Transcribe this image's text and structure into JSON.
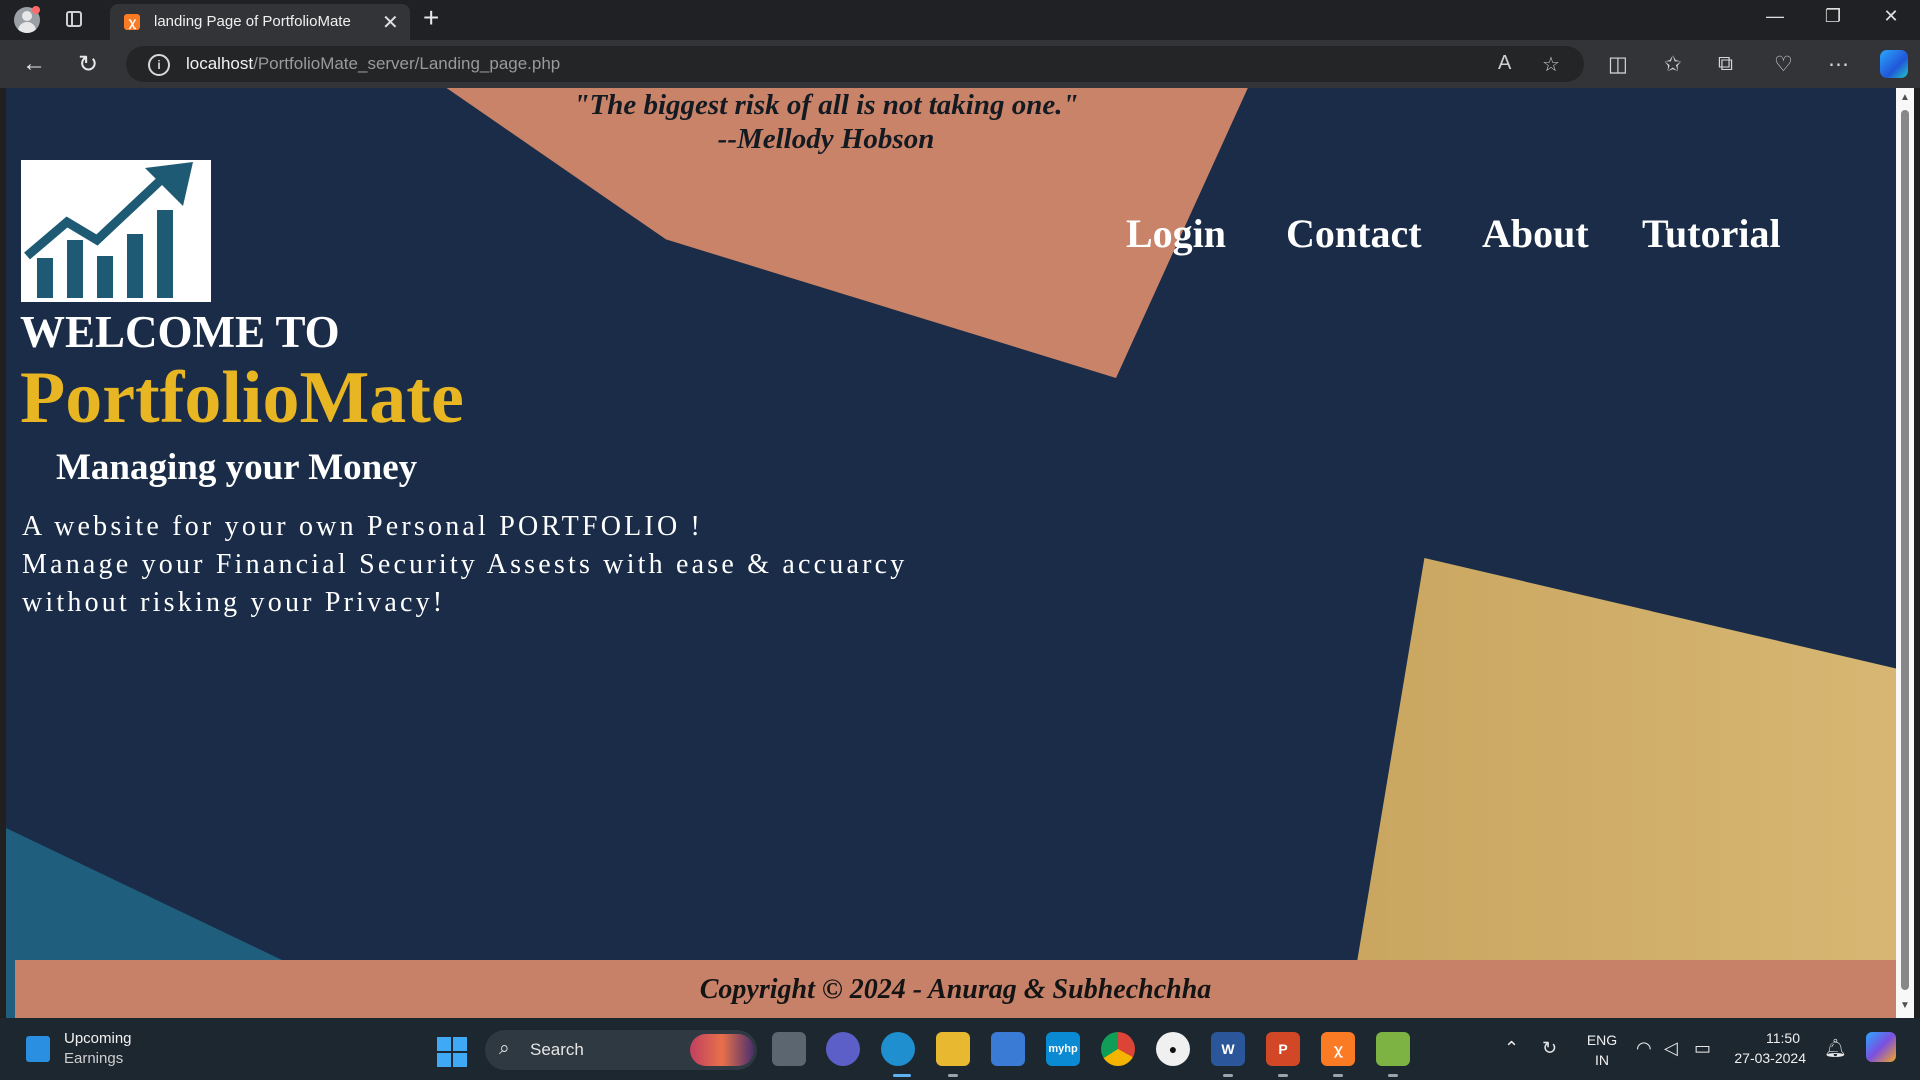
{
  "browser": {
    "tab_title": "landing Page of PortfolioMate",
    "favicon_glyph": "ꭓ",
    "url_host": "localhost",
    "url_path": "/PortfolioMate_server/Landing_page.php",
    "close_glyph": "✕",
    "new_tab_glyph": "+",
    "minimize_glyph": "—",
    "restore_glyph": "❐",
    "window_close_glyph": "✕",
    "back_glyph": "←",
    "refresh_glyph": "↻",
    "read_aloud_glyph": "A",
    "favorite_glyph": "☆",
    "split_glyph": "◫",
    "favorites_glyph": "✩",
    "collections_glyph": "⧉",
    "performance_glyph": "♡",
    "more_glyph": "⋯"
  },
  "page": {
    "quote_line1": "\"The biggest risk of all is not taking one.\"",
    "quote_line2": "--Mellody Hobson",
    "nav": [
      "Login",
      "Contact",
      "About",
      "Tutorial"
    ],
    "welcome": "WELCOME TO",
    "brand": "PortfolioMate",
    "tagline": "Managing your Money",
    "description_line1": "A website for your own Personal PORTFOLIO !",
    "description_line2": "Manage your Financial Security Assests with ease & accuarcy",
    "description_line3": "without risking your Privacy!",
    "footer": "Copyright © 2024 - Anurag & Subhechchha",
    "colors": {
      "background": "#1a2c47",
      "brand_gold": "#e7b622",
      "peach": "#c98368",
      "logo_blue": "#1e5a73"
    }
  },
  "taskbar": {
    "weather_title": "Upcoming",
    "weather_sub": "Earnings",
    "search_label": "Search",
    "language_line1": "ENG",
    "language_line2": "IN",
    "time": "11:50",
    "date": "27-03-2024",
    "apps": [
      "task-view",
      "chat",
      "edge",
      "file-explorer",
      "store",
      "myhp",
      "chrome",
      "github",
      "word",
      "powerpoint",
      "xampp",
      "notepad"
    ]
  }
}
